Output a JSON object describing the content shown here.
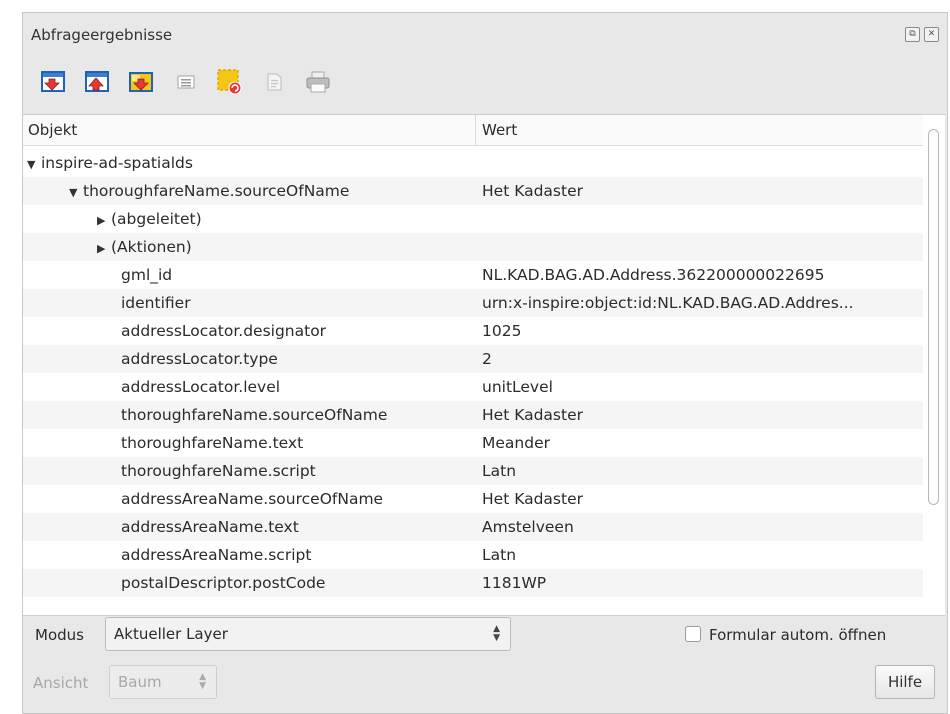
{
  "panel": {
    "title": "Abfrageergebnisse",
    "float_glyph": "⧉",
    "close_glyph": "✕"
  },
  "toolbar": [
    {
      "name": "expand-tree-icon"
    },
    {
      "name": "collapse-tree-icon"
    },
    {
      "name": "expand-new-results-icon"
    },
    {
      "name": "open-form-icon"
    },
    {
      "name": "clear-results-icon"
    },
    {
      "name": "copy-feature-icon"
    },
    {
      "name": "print-icon"
    }
  ],
  "columns": {
    "object": "Objekt",
    "value": "Wert"
  },
  "rows": [
    {
      "key": "inspire-ad-spatialds",
      "value": "",
      "indent": 0,
      "arrow": "▼"
    },
    {
      "key": "thoroughfareName.sourceOfName",
      "value": "Het Kadaster",
      "indent": 1,
      "arrow": "▼"
    },
    {
      "key": "(abgeleitet)",
      "value": "",
      "indent": 2,
      "arrow": "▶"
    },
    {
      "key": "(Aktionen)",
      "value": "",
      "indent": 2,
      "arrow": "▶"
    },
    {
      "key": "gml_id",
      "value": "NL.KAD.BAG.AD.Address.362200000022695",
      "indent": 3,
      "arrow": ""
    },
    {
      "key": "identifier",
      "value": "urn:x-inspire:object:id:NL.KAD.BAG.AD.Addres...",
      "indent": 3,
      "arrow": ""
    },
    {
      "key": "addressLocator.designator",
      "value": "1025",
      "indent": 3,
      "arrow": ""
    },
    {
      "key": "addressLocator.type",
      "value": "2",
      "indent": 3,
      "arrow": ""
    },
    {
      "key": "addressLocator.level",
      "value": "unitLevel",
      "indent": 3,
      "arrow": ""
    },
    {
      "key": "thoroughfareName.sourceOfName",
      "value": "Het Kadaster",
      "indent": 3,
      "arrow": ""
    },
    {
      "key": "thoroughfareName.text",
      "value": "Meander",
      "indent": 3,
      "arrow": ""
    },
    {
      "key": "thoroughfareName.script",
      "value": "Latn",
      "indent": 3,
      "arrow": ""
    },
    {
      "key": "addressAreaName.sourceOfName",
      "value": "Het Kadaster",
      "indent": 3,
      "arrow": ""
    },
    {
      "key": "addressAreaName.text",
      "value": "Amstelveen",
      "indent": 3,
      "arrow": ""
    },
    {
      "key": "addressAreaName.script",
      "value": "Latn",
      "indent": 3,
      "arrow": ""
    },
    {
      "key": "postalDescriptor.postCode",
      "value": "1181WP",
      "indent": 3,
      "arrow": ""
    }
  ],
  "bottom": {
    "mode_label": "Modus",
    "mode_value": "Aktueller Layer",
    "auto_form_label": "Formular autom. öffnen",
    "auto_form_checked": false,
    "view_label": "Ansicht",
    "view_value": "Baum",
    "help_label": "Hilfe"
  },
  "colors": {
    "panel_bg": "#e8e8e8",
    "row_alt": "#f5f5f5",
    "icon_red": "#e53935",
    "icon_blue": "#1e63b6",
    "icon_yellow": "#f5c518"
  }
}
